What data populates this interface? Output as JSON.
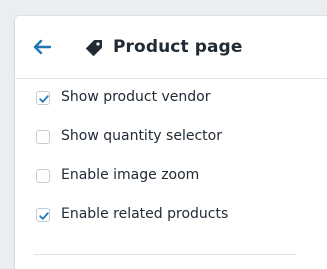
{
  "header": {
    "title": "Product page",
    "back_icon": "arrow-left-icon",
    "title_icon": "tag-icon",
    "accent_color": "#1e76b4"
  },
  "options": [
    {
      "label": "Show product vendor",
      "checked": true
    },
    {
      "label": "Show quantity selector",
      "checked": false
    },
    {
      "label": "Enable image zoom",
      "checked": false
    },
    {
      "label": "Enable related products",
      "checked": true
    }
  ]
}
